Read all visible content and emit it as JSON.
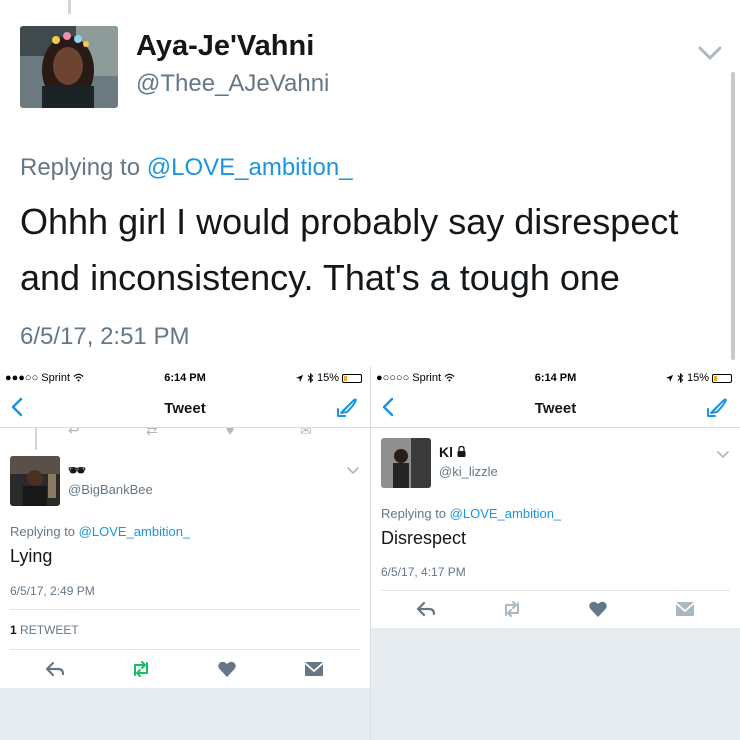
{
  "top_tweet": {
    "name": "Aya-Je'Vahni",
    "handle": "@Thee_AJeVahni",
    "replying_prefix": "Replying to",
    "replying_mention": "@LOVE_ambition_",
    "text": "Ohhh girl I would probably say disrespect and inconsistency. That's a tough one",
    "timestamp": "6/5/17, 2:51 PM"
  },
  "left_screen": {
    "status_bar": {
      "carrier": "●●●○○ Sprint",
      "time": "6:14 PM",
      "battery": "15%"
    },
    "nav": {
      "title": "Tweet"
    },
    "tweet": {
      "name": "🕶",
      "handle": "@BigBankBee",
      "replying_prefix": "Replying to",
      "replying_mention": "@LOVE_ambition_",
      "text": "Lying",
      "timestamp": "6/5/17, 2:49 PM",
      "retweet_count": "1",
      "retweet_label": "RETWEET"
    }
  },
  "right_screen": {
    "status_bar": {
      "carrier": "●○○○○ Sprint",
      "time": "6:14 PM",
      "battery": "15%"
    },
    "nav": {
      "title": "Tweet"
    },
    "tweet": {
      "name": "Kl",
      "handle": "@ki_lizzle",
      "replying_prefix": "Replying to",
      "replying_mention": "@LOVE_ambition_",
      "text": "Disrespect",
      "timestamp": "6/5/17, 4:17 PM"
    }
  },
  "icons": {
    "status_bar": [
      "wifi-icon",
      "location-icon",
      "bluetooth-icon",
      "battery-icon"
    ],
    "nav": [
      "back-chevron-icon",
      "compose-icon"
    ],
    "tweet": [
      "caret-down-icon",
      "reply-icon",
      "retweet-icon",
      "like-heart-icon",
      "direct-message-icon",
      "lock-icon"
    ]
  },
  "colors": {
    "link_blue": "#1b95e0",
    "retweet_green": "#17bf63",
    "secondary_text": "#657786",
    "background_gray": "#e6ecf0"
  }
}
